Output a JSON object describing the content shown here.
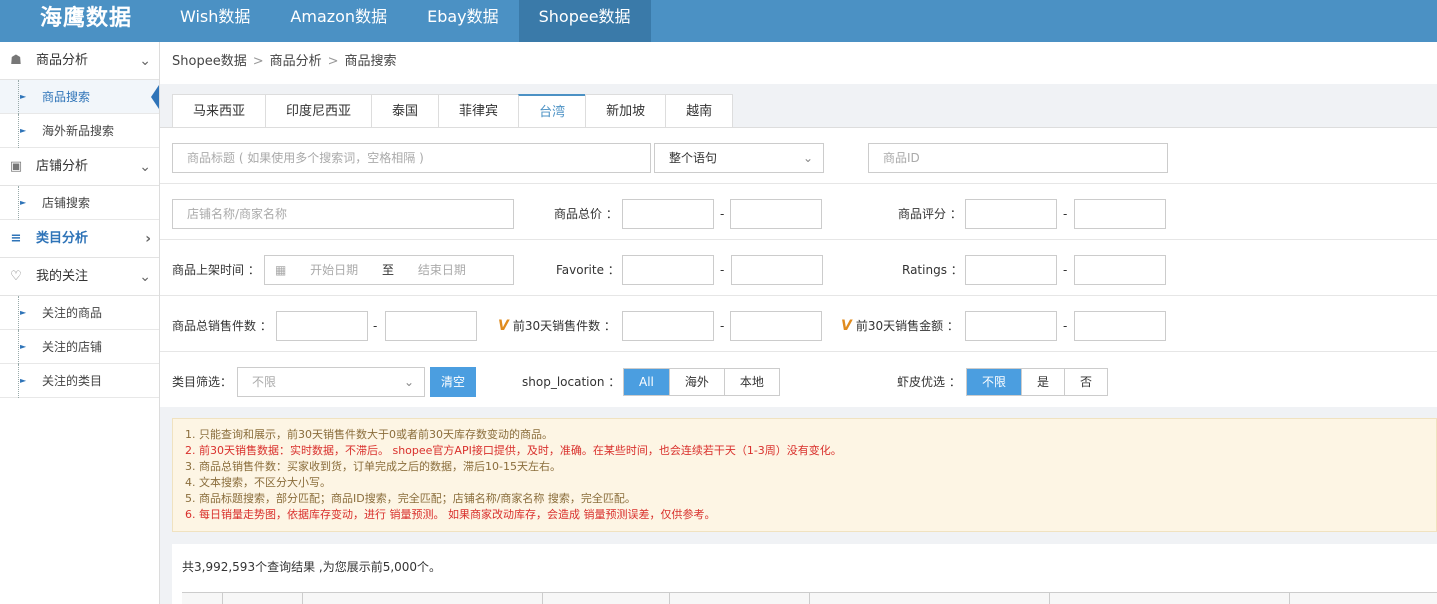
{
  "brand": {
    "logo": "海鹰数据"
  },
  "topnav": [
    {
      "label": "Wish数据",
      "active": false
    },
    {
      "label": "Amazon数据",
      "active": false
    },
    {
      "label": "Ebay数据",
      "active": false
    },
    {
      "label": "Shopee数据",
      "active": true
    }
  ],
  "sidebar": {
    "product_analysis": {
      "label": "商品分析",
      "items": [
        "商品搜索",
        "海外新品搜索"
      ]
    },
    "shop_analysis": {
      "label": "店铺分析",
      "items": [
        "店铺搜索"
      ]
    },
    "category_analysis": {
      "label": "类目分析"
    },
    "my_follow": {
      "label": "我的关注",
      "items": [
        "关注的商品",
        "关注的店铺",
        "关注的类目"
      ]
    }
  },
  "breadcrumb": [
    "Shopee数据",
    "商品分析",
    "商品搜索"
  ],
  "tabs": [
    {
      "label": "马来西亚",
      "active": false
    },
    {
      "label": "印度尼西亚",
      "active": false
    },
    {
      "label": "泰国",
      "active": false
    },
    {
      "label": "菲律宾",
      "active": false
    },
    {
      "label": "台湾",
      "active": true
    },
    {
      "label": "新加坡",
      "active": false
    },
    {
      "label": "越南",
      "active": false
    }
  ],
  "filters": {
    "title_placeholder": "商品标题 ( 如果使用多个搜索词，空格相隔 )",
    "match_mode": "整个语句",
    "product_id_placeholder": "商品ID",
    "shop_name_placeholder": "店铺名称/商家名称",
    "total_price_label": "商品总价 ：",
    "rating_label": "商品评分 ：",
    "listing_time_label": "商品上架时间 ：",
    "start_date_placeholder": "开始日期",
    "date_to": "至",
    "end_date_placeholder": "结束日期",
    "favorite_label": "Favorite ：",
    "ratings_label": "Ratings ：",
    "total_sold_label": "商品总销售件数 ：",
    "sold_30d_label": "前30天销售件数 ：",
    "amount_30d_label": "前30天销售金额 ：",
    "vip_mark": "V",
    "category_label": "类目筛选：",
    "category_value": "不限",
    "clear_button": "清空",
    "shop_location_label": "shop_location ：",
    "shop_location_options": [
      {
        "label": "All",
        "active": true
      },
      {
        "label": "海外",
        "active": false
      },
      {
        "label": "本地",
        "active": false
      }
    ],
    "preferred_label": "虾皮优选 ：",
    "preferred_options": [
      {
        "label": "不限",
        "active": true
      },
      {
        "label": "是",
        "active": false
      },
      {
        "label": "否",
        "active": false
      }
    ],
    "range_dash": "-"
  },
  "notes": [
    {
      "text": "1. 只能查询和展示，前30天销售件数大于0或者前30天库存数变动的商品。",
      "highlight": false
    },
    {
      "text": "2. 前30天销售数据：实时数据，不滞后。 shopee官方API接口提供，及时，准确。在某些时间，也会连续若干天（1-3周）没有变化。",
      "highlight": true
    },
    {
      "text": "3. 商品总销售件数：买家收到货，订单完成之后的数据，滞后10-15天左右。",
      "highlight": false
    },
    {
      "text": "4. 文本搜索，不区分大小写。",
      "highlight": false
    },
    {
      "text": "5. 商品标题搜索，部分匹配；商品ID搜索，完全匹配；店铺名称/商家名称 搜索，完全匹配。",
      "highlight": false
    },
    {
      "text": "6. 每日销量走势图，依据库存变动，进行 销量预测。 如果商家改动库存，会造成 销量预测误差，仅供参考。",
      "highlight": true
    }
  ],
  "results": {
    "summary": "共3,992,593个查询结果 ,为您展示前5,000个。"
  },
  "icons": {
    "product": "bag-icon",
    "shop": "shop-icon",
    "category": "list-icon",
    "follow": "heart-icon",
    "calendar": "calendar-icon"
  },
  "colors": {
    "topbar": "#4b91c4",
    "accent": "#4b9ee0",
    "note_red": "#d9302c",
    "note_bg": "#fdf5e4"
  }
}
